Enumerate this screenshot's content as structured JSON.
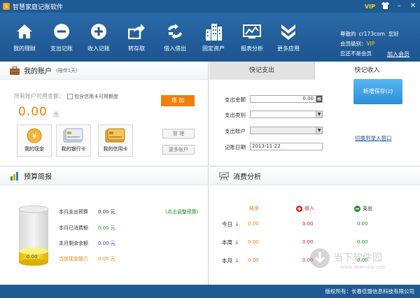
{
  "window": {
    "title": "智慧家庭记账软件",
    "vip_badge": "VIP"
  },
  "toolbar": {
    "items": [
      {
        "label": "我的理财",
        "icon": "home-icon"
      },
      {
        "label": "支出记账",
        "icon": "minus-circle-icon"
      },
      {
        "label": "收入记账",
        "icon": "plus-circle-icon"
      },
      {
        "label": "转存取",
        "icon": "transfer-icon"
      },
      {
        "label": "借入借出",
        "icon": "exchange-icon"
      },
      {
        "label": "固定资产",
        "icon": "building-icon"
      },
      {
        "label": "报表分析",
        "icon": "chart-icon"
      },
      {
        "label": "更多应用",
        "icon": "chevrons-down-icon"
      }
    ]
  },
  "user": {
    "greeting_prefix": "尊敬的",
    "name": "cr173com",
    "greeting_suffix": "您好",
    "level_label": "会员级别：",
    "level_value": "VIP",
    "not_member": "您还不是会员",
    "join_link": "加入会员"
  },
  "account": {
    "title": "我的账户",
    "subtitle": "(陪伴1天)",
    "available_label": "所有账户可用金额：",
    "include_credit_label": "包含信用卡可用额度",
    "add_button": "增 加",
    "amount": "0.00",
    "unit": "元",
    "cards": [
      {
        "label": "我的现金"
      },
      {
        "label": "我的银行卡"
      },
      {
        "label": "我的信用卡"
      }
    ],
    "manage_button": "管 理",
    "more_button": "更多账户"
  },
  "quick_entry": {
    "tab_expense": "快记支出",
    "tab_income": "快记收入",
    "amount_label": "支出金额",
    "amount_value": "0.00",
    "category_label": "支出类别",
    "account_label": "支出账户",
    "date_label": "记账日期",
    "date_value": "2013-11-22",
    "save_button": "新增保存(z)",
    "switch_link": "切换到录入窗口"
  },
  "budget": {
    "title": "预算简报",
    "cylinder_value": "0.00",
    "rows": [
      {
        "label": "本月支出预算",
        "value": "0.00 元",
        "color": "#333333"
      },
      {
        "label": "本月已消费额",
        "value": "0.00 元",
        "color": "#2a8a2a"
      },
      {
        "label": "本月剩余余额",
        "value": "0.00 元",
        "color": "#3a3ab0"
      },
      {
        "label": "当前现金能力",
        "value": "0.00 元",
        "color": "#f07f0e"
      }
    ],
    "adjust_link": "(点击调整预算)"
  },
  "consumption": {
    "title": "消费分析",
    "col_balance": "结余",
    "col_income": "收入",
    "col_expense": "支出",
    "rows": [
      {
        "label": "今日",
        "balance": "0.00",
        "income": "0.00",
        "expense": "0.00"
      },
      {
        "label": "本周",
        "balance": "0.00",
        "income": "0.00",
        "expense": "0.00"
      },
      {
        "label": "本月",
        "balance": "0.00",
        "income": "0.00",
        "expense": "0.00"
      }
    ]
  },
  "watermark": {
    "text": "当下软件园",
    "url": "www.downxia.com"
  },
  "statusbar": {
    "copyright": "版权所有：长春佳盟信息科技有限公司"
  },
  "colors": {
    "primary": "#1e5a93",
    "accent": "#f07f0e",
    "save_button": "#2a8fd8",
    "positive": "#2a8a2a",
    "income": "#d02020"
  }
}
